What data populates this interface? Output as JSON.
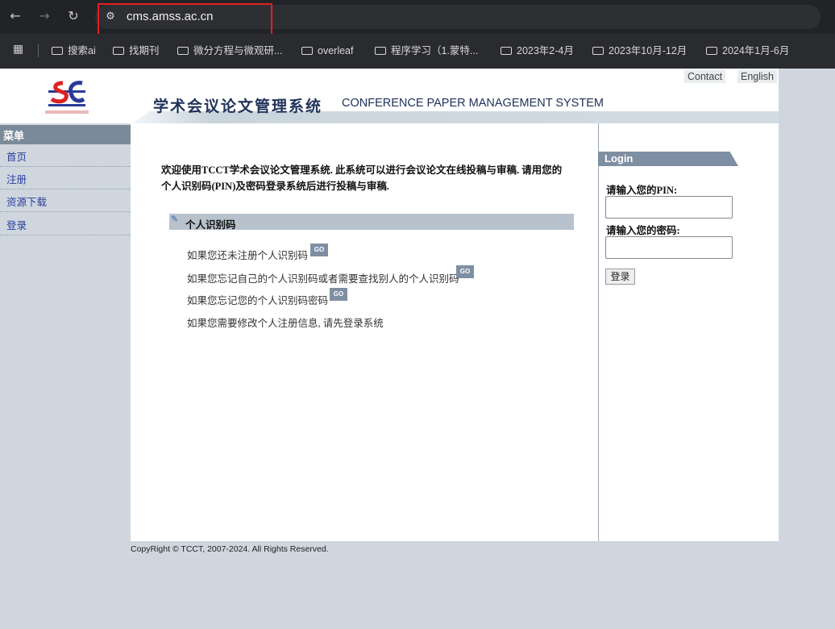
{
  "browser": {
    "url": "cms.amss.ac.cn",
    "bookmarks": [
      "搜索ai",
      "找期刊",
      "微分方程与微观研...",
      "overleaf",
      "程序学习（1.蒙特...",
      "2023年2-4月",
      "2023年10月-12月",
      "2024年1月-6月"
    ]
  },
  "header": {
    "title_cn": "学术会议论文管理系统",
    "title_en": "CONFERENCE PAPER MANAGEMENT SYSTEM",
    "links": {
      "contact": "Contact",
      "english": "English"
    }
  },
  "menu": {
    "heading": "菜单",
    "items": [
      "首页",
      "注册",
      "资源下载",
      "登录"
    ]
  },
  "main": {
    "welcome_line1": "欢迎使用TCCT学术会议论文管理系统. 此系统可以进行会议论文在线投稿与审稿. 请用您的",
    "welcome_line2": "个人识别码(PIN)及密码登录系统后进行投稿与审稿.",
    "section_title": "个人识别码",
    "rows": [
      "如果您还未注册个人识别码",
      "如果您忘记自己的个人识别码或者需要查找别人的个人识别码",
      "如果您忘记您的个人识别码密码",
      "如果您需要修改个人注册信息, 请先登录系统"
    ],
    "go_label": "GO"
  },
  "login": {
    "heading": "Login",
    "pin_label": "请输入您的PIN:",
    "password_label": "请输入您的密码:",
    "button": "登录"
  },
  "footer": "CopyRight © TCCT, 2007-2024. All Rights Reserved.",
  "colors": {
    "accent": "#7f8fa3",
    "menu_link": "#2a3ea0",
    "highlight": "#e02020"
  }
}
